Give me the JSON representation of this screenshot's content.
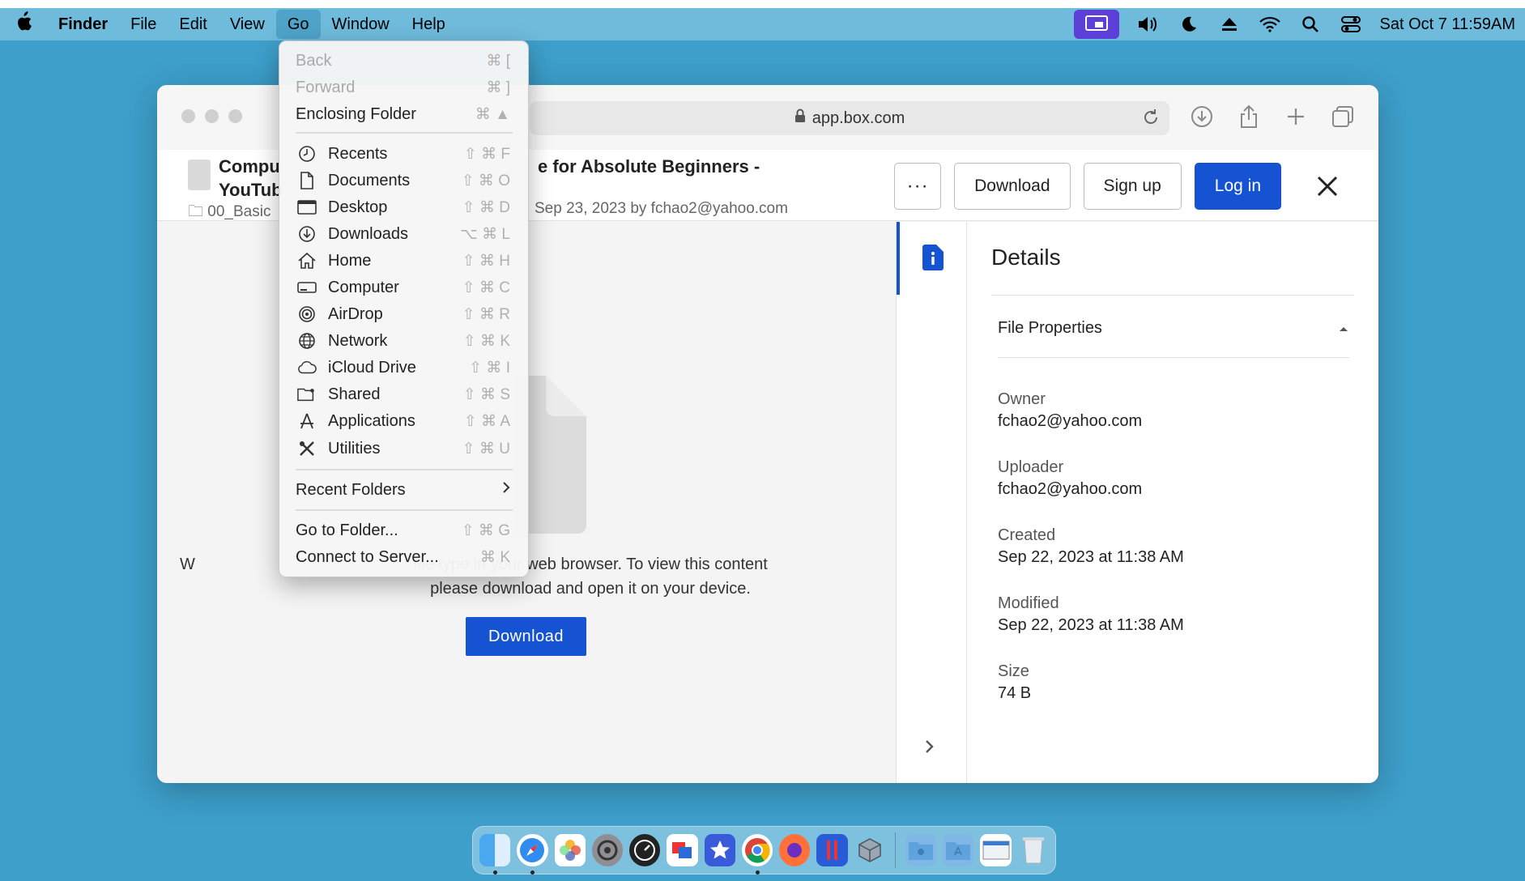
{
  "menubar": {
    "app_name": "Finder",
    "items": [
      "File",
      "Edit",
      "View",
      "Go",
      "Window",
      "Help"
    ],
    "active": "Go",
    "clock": "Sat Oct 7  11:59AM"
  },
  "browser": {
    "url": "app.box.com"
  },
  "file": {
    "title_line1": "Compu",
    "title_line2": "YouTub",
    "title_rest": "e for Absolute Beginners -",
    "folder": "00_Basic",
    "modified_meta": "Sep 23, 2023 by fchao2@yahoo.com"
  },
  "header_actions": {
    "more": "···",
    "download": "Download",
    "signup": "Sign up",
    "login": "Log in"
  },
  "preview": {
    "message_lead": "W",
    "message_rest": "file type in your web browser. To view this content please download and open it on your device.",
    "download_label": "Download"
  },
  "details": {
    "title": "Details",
    "section": "File Properties",
    "props": [
      {
        "label": "Owner",
        "value": "fchao2@yahoo.com"
      },
      {
        "label": "Uploader",
        "value": "fchao2@yahoo.com"
      },
      {
        "label": "Created",
        "value": "Sep 22, 2023 at 11:38 AM"
      },
      {
        "label": "Modified",
        "value": "Sep 22, 2023 at 11:38 AM"
      },
      {
        "label": "Size",
        "value": "74 B"
      }
    ]
  },
  "go_menu": {
    "back": {
      "label": "Back",
      "shortcut": "⌘ ["
    },
    "forward": {
      "label": "Forward",
      "shortcut": "⌘ ]"
    },
    "enclosing": {
      "label": "Enclosing Folder",
      "shortcut": "⌘ ▲"
    },
    "places": [
      {
        "label": "Recents",
        "shortcut": "⇧ ⌘ F",
        "icon": "clock-icon"
      },
      {
        "label": "Documents",
        "shortcut": "⇧ ⌘ O",
        "icon": "document-icon"
      },
      {
        "label": "Desktop",
        "shortcut": "⇧ ⌘ D",
        "icon": "desktop-icon"
      },
      {
        "label": "Downloads",
        "shortcut": "⌥ ⌘ L",
        "icon": "download-icon"
      },
      {
        "label": "Home",
        "shortcut": "⇧ ⌘ H",
        "icon": "home-icon"
      },
      {
        "label": "Computer",
        "shortcut": "⇧ ⌘ C",
        "icon": "computer-icon"
      },
      {
        "label": "AirDrop",
        "shortcut": "⇧ ⌘ R",
        "icon": "airdrop-icon"
      },
      {
        "label": "Network",
        "shortcut": "⇧ ⌘ K",
        "icon": "globe-icon"
      },
      {
        "label": "iCloud Drive",
        "shortcut": "⇧ ⌘ I",
        "icon": "cloud-icon"
      },
      {
        "label": "Shared",
        "shortcut": "⇧ ⌘ S",
        "icon": "shared-folder-icon"
      },
      {
        "label": "Applications",
        "shortcut": "⇧ ⌘ A",
        "icon": "applications-icon"
      },
      {
        "label": "Utilities",
        "shortcut": "⇧ ⌘ U",
        "icon": "utilities-icon"
      }
    ],
    "recent_folders": "Recent Folders",
    "go_to_folder": {
      "label": "Go to Folder...",
      "shortcut": "⇧ ⌘ G"
    },
    "connect": {
      "label": "Connect to Server...",
      "shortcut": "⌘ K"
    }
  },
  "dock": [
    "finder-icon",
    "safari-icon",
    "photos-icon",
    "system-preferences-icon",
    "activity-monitor-icon",
    "remote-desktop-icon",
    "imovie-icon",
    "chrome-icon",
    "firefox-icon",
    "parallels-icon",
    "virtualbox-icon",
    "folder-icon",
    "applications-folder-icon",
    "preview-icon",
    "trash-icon"
  ],
  "colors": {
    "accent": "#1553d3",
    "desktop": "#3d9fca",
    "menubar": "#6fbbdc"
  }
}
